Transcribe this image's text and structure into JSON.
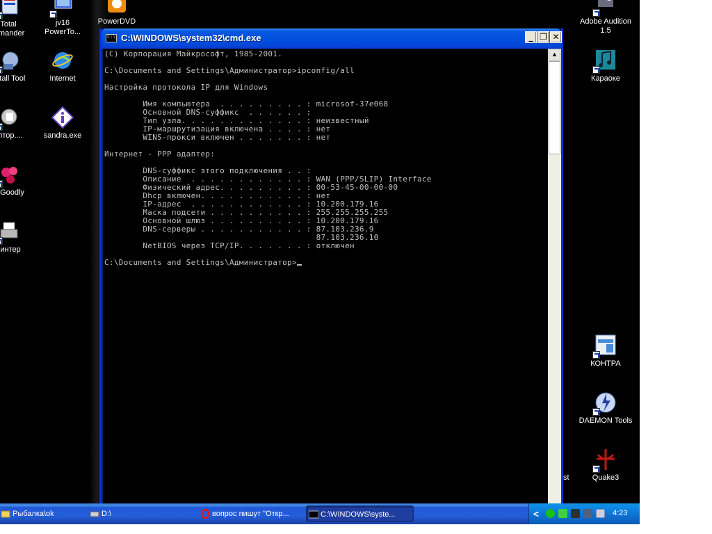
{
  "desktop": {
    "left_icons": [
      {
        "label": "Total\nmmander",
        "icon": "total-commander-icon"
      },
      {
        "label": "nstall Tool",
        "icon": "install-tool-icon"
      },
      {
        "label": "ептор....",
        "icon": "editor-icon"
      },
      {
        "label": "ic Goodly",
        "icon": "goodly-icon"
      },
      {
        "label": "оинтер",
        "icon": "printer-icon"
      }
    ],
    "col2_icons": [
      {
        "label": "jv16\nPowerTo...",
        "icon": "jv16-icon"
      },
      {
        "label": "Internet",
        "icon": "internet-explorer-icon"
      },
      {
        "label": "sandra.exe",
        "icon": "sandra-icon"
      }
    ],
    "powerdvd_label": "PowerDVD",
    "right_icons": [
      {
        "label": "Adobe Audition\n1.5",
        "icon": "adobe-audition-icon"
      },
      {
        "label": "Караоке",
        "icon": "karaoke-icon"
      },
      {
        "label": "КОНТРА",
        "icon": "kontra-icon"
      },
      {
        "label": "DAEMON Tools",
        "icon": "daemon-tools-icon"
      },
      {
        "label": "Quake3",
        "icon": "quake3-icon"
      }
    ],
    "partial_label": "st"
  },
  "cmd_window": {
    "title": "C:\\WINDOWS\\system32\\cmd.exe",
    "buttons": {
      "minimize": "_",
      "maximize": "❐",
      "close": "✕"
    },
    "lines": [
      "(C) Корпорация Майкрософт, 1985-2001.",
      "",
      "C:\\Documents and Settings\\Администратор>ipconfig/all",
      "",
      "Настройка протокола IP для Windows",
      "",
      "        Имя компьютера  . . . . . . . . . : microsof-37e068",
      "        Основной DNS-суффикс  . . . . . . :",
      "        Тип узла. . . . . . . . . . . . . : неизвестный",
      "        IP-маршрутизация включена . . . . : нет",
      "        WINS-прокси включен . . . . . . . : нет",
      "",
      "Интернет - PPP адаптер:",
      "",
      "        DNS-суффикс этого подключения . . :",
      "        Описание  . . . . . . . . . . . . : WAN (PPP/SLIP) Interface",
      "        Физический адрес. . . . . . . . . : 00-53-45-00-00-00",
      "        Dhcp включен. . . . . . . . . . . : нет",
      "        IP-адрес  . . . . . . . . . . . . : 10.200.179.16",
      "        Маска подсети . . . . . . . . . . : 255.255.255.255",
      "        Основной шлюз . . . . . . . . . . : 10.200.179.16",
      "        DNS-серверы . . . . . . . . . . . : 87.103.236.9",
      "                                            87.103.236.10",
      "        NetBIOS через TCP/IP. . . . . . . : отключен",
      ""
    ],
    "prompt": "C:\\Documents and Settings\\Администратор>"
  },
  "taskbar": {
    "tasks": [
      {
        "label": "Рыбалка\\ok",
        "icon": "folder-icon"
      },
      {
        "label": "D:\\",
        "icon": "drive-icon"
      },
      {
        "label": "вопрос пишут \"Откр...",
        "icon": "opera-icon"
      },
      {
        "label": "C:\\WINDOWS\\syste...",
        "icon": "cmd-icon"
      }
    ],
    "clock": "4:23",
    "tray_chevron": "<"
  },
  "colors": {
    "console_bg": "#000000",
    "console_text": "#c0c0c0",
    "titlebar": "#0150dd",
    "taskbar": "#245edb"
  }
}
